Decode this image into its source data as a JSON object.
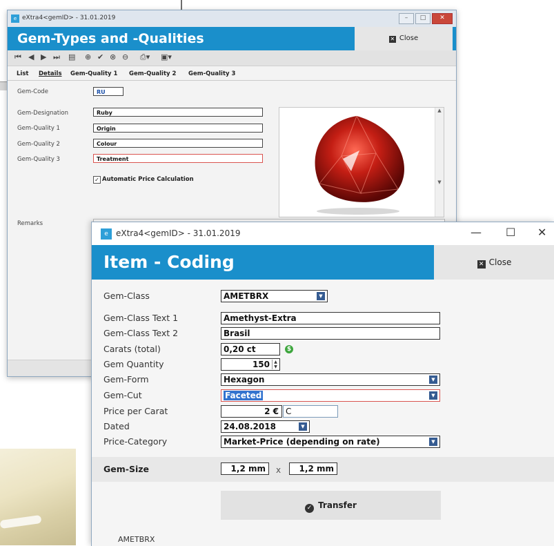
{
  "window1": {
    "title": "eXtra4<gemID> - 31.01.2019",
    "header_title": "Gem-Types and -Qualities",
    "close_label": "Close",
    "tabs": [
      "List",
      "Details",
      "Gem-Quality 1",
      "Gem-Quality 2",
      "Gem-Quality 3"
    ],
    "fields": {
      "gem_code_label": "Gem-Code",
      "gem_code_value": "RU",
      "designation_label": "Gem-Designation",
      "designation_value": "Ruby",
      "quality1_label": "Gem-Quality 1",
      "quality1_value": "Origin",
      "quality2_label": "Gem-Quality 2",
      "quality2_value": "Colour",
      "quality3_label": "Gem-Quality 3",
      "quality3_value": "Treatment",
      "auto_price_label": "Automatic Price Calculation",
      "remarks_label": "Remarks"
    }
  },
  "window2": {
    "title": "eXtra4<gemID> - 31.01.2019",
    "header_title": "Item - Coding",
    "close_label": "Close",
    "fields": {
      "gem_class_label": "Gem-Class",
      "gem_class_value": "AMETBRX",
      "class_text1_label": "Gem-Class Text 1",
      "class_text1_value": "Amethyst-Extra",
      "class_text2_label": "Gem-Class Text 2",
      "class_text2_value": "Brasil",
      "carats_label": "Carats (total)",
      "carats_value": "0,20 ct",
      "quantity_label": "Gem Quantity",
      "quantity_value": "150",
      "form_label": "Gem-Form",
      "form_value": "Hexagon",
      "cut_label": "Gem-Cut",
      "cut_value": "Faceted",
      "price_label": "Price per Carat",
      "price_value": "2 €",
      "price_code_value": "C",
      "dated_label": "Dated",
      "dated_value": "24.08.2018",
      "price_category_label": "Price-Category",
      "price_category_value": "Market-Price (depending on rate)",
      "gem_size_label": "Gem-Size",
      "size_w_value": "1,2 mm",
      "size_x_sep": "x",
      "size_h_value": "1,2 mm"
    },
    "transfer_label": "Transfer",
    "footer_text": "AMETBRX"
  }
}
